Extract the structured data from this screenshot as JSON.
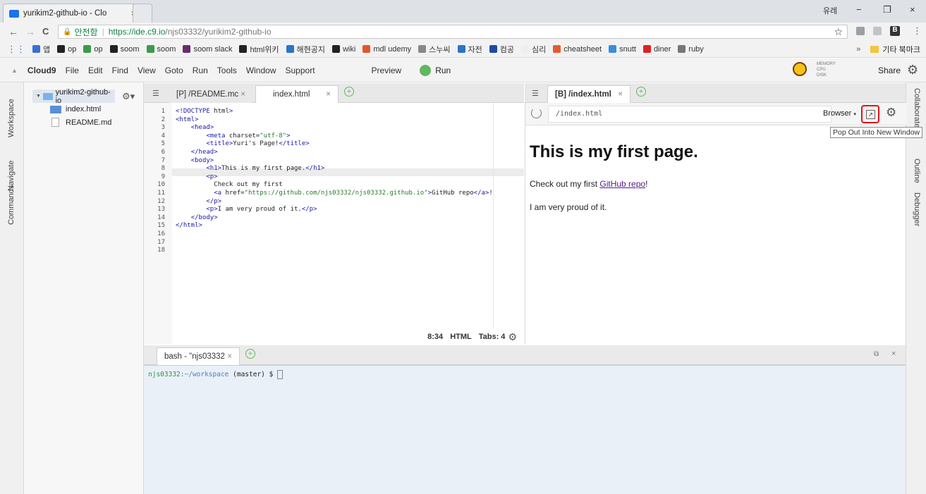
{
  "browser": {
    "tab_title": "yurikim2-github-io - Clo",
    "tab_close": "×",
    "profile": "유레",
    "min": "−",
    "restore": "❐",
    "close": "×",
    "secure_label": "안전함",
    "url_host": "https://ide.c9.io",
    "url_path": "/njs03332/yurikim2-github-io",
    "back": "←",
    "forward": "→",
    "reload": "C",
    "star": "☆",
    "bookmarks": [
      {
        "label": "앱",
        "color": "#3a6fd8"
      },
      {
        "label": "op",
        "color": "#222"
      },
      {
        "label": "op",
        "color": "#3c9a4c"
      },
      {
        "label": "soom",
        "color": "#222"
      },
      {
        "label": "soom",
        "color": "#3c9a4c"
      },
      {
        "label": "soom slack",
        "color": "#6b2c6f"
      },
      {
        "label": "html위키",
        "color": "#222"
      },
      {
        "label": "해현공지",
        "color": "#2b74c7"
      },
      {
        "label": "wiki",
        "color": "#222"
      },
      {
        "label": "mdl udemy",
        "color": "#e2572d"
      },
      {
        "label": "스누씨",
        "color": "#888"
      },
      {
        "label": "자전",
        "color": "#2b74c7"
      },
      {
        "label": "컴공",
        "color": "#1e4aa8"
      },
      {
        "label": "심리",
        "color": "#eeeeee"
      },
      {
        "label": "cheatsheet",
        "color": "#e45c2b"
      },
      {
        "label": "snutt",
        "color": "#3a8dde"
      },
      {
        "label": "diner",
        "color": "#e02020"
      },
      {
        "label": "ruby",
        "color": "#777"
      }
    ],
    "more_bookmarks": "»",
    "other_bookmarks": "기타 북마크"
  },
  "menubar": {
    "items": [
      "Cloud9",
      "File",
      "Edit",
      "Find",
      "View",
      "Goto",
      "Run",
      "Tools",
      "Window",
      "Support"
    ],
    "preview": "Preview",
    "run": "Run",
    "memory": "MEMORY",
    "cpu": "CPU",
    "disk": "DISK",
    "share": "Share"
  },
  "leftbar": {
    "workspace": "Workspace",
    "navigate": "Navigate",
    "commands": "Commands"
  },
  "rightbar": {
    "collaborate": "Collaborate",
    "outline": "Outline",
    "debugger": "Debugger"
  },
  "tree": {
    "root": "yurikim2-github-io",
    "files": [
      "index.html",
      "README.md"
    ]
  },
  "editor": {
    "tab1": "[P] /README.mc",
    "tab2": "index.html",
    "close": "×",
    "lines": [
      {
        "n": "1",
        "t": "<!DOCTYPE html>"
      },
      {
        "n": "2",
        "t": "<html>"
      },
      {
        "n": "3",
        "t": "    <head>"
      },
      {
        "n": "4",
        "t": "        <meta charset=\"utf-8\">"
      },
      {
        "n": "5",
        "t": "        <title>Yuri's Page!</title>"
      },
      {
        "n": "6",
        "t": "    </head>"
      },
      {
        "n": "7",
        "t": "    <body>"
      },
      {
        "n": "8",
        "t": "        <h1>This is my first page.</h1>"
      },
      {
        "n": "9",
        "t": "        <p>"
      },
      {
        "n": "10",
        "t": "          Check out my first"
      },
      {
        "n": "11",
        "t": "          <a href=\"https://github.com/njs03332/njs03332.github.io\">GitHub repo</a>!"
      },
      {
        "n": "12",
        "t": "        </p>"
      },
      {
        "n": "13",
        "t": "        <p>I am very proud of it.</p>"
      },
      {
        "n": "14",
        "t": "    </body>"
      },
      {
        "n": "15",
        "t": "</html>"
      },
      {
        "n": "16",
        "t": ""
      },
      {
        "n": "17",
        "t": ""
      },
      {
        "n": "18",
        "t": ""
      }
    ],
    "cursor_pos": "8:34",
    "mode": "HTML",
    "tabs": "Tabs: 4"
  },
  "preview": {
    "tab": "[B] /index.html",
    "url": "/index.html",
    "browser_btn": "Browser",
    "tooltip": "Pop Out Into New Window",
    "h1": "This is my first page.",
    "p1_pre": "Check out my first ",
    "p1_link": "GitHub repo",
    "p1_post": "!",
    "p2": "I am very proud of it."
  },
  "terminal": {
    "tab": "bash - \"njs03332",
    "prompt_user": "njs03332",
    "prompt_path": ":~/workspace",
    "prompt_branch": " (master) $ "
  }
}
